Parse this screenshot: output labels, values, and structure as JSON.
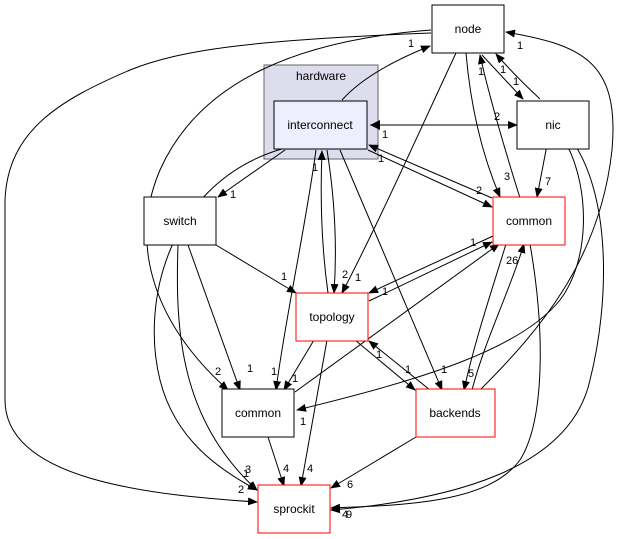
{
  "cluster": {
    "label": "hardware"
  },
  "colors": {
    "cluster_fill": "#ddddee",
    "cluster_stroke": "#666666",
    "inner_fill": "#eeeeff",
    "normal_stroke": "#000000",
    "red_stroke": "#ff0000"
  },
  "nodes": {
    "interconnect": {
      "label": "interconnect"
    },
    "node": {
      "label": "node"
    },
    "nic": {
      "label": "nic"
    },
    "common_right": {
      "label": "common"
    },
    "switch": {
      "label": "switch"
    },
    "topology": {
      "label": "topology"
    },
    "common_left": {
      "label": "common"
    },
    "backends": {
      "label": "backends"
    },
    "sprockit": {
      "label": "sprockit"
    }
  },
  "edges": [
    {
      "from": "interconnect",
      "to": "node",
      "label": "1"
    },
    {
      "from": "interconnect",
      "to": "nic",
      "label": "2"
    },
    {
      "from": "nic",
      "to": "interconnect",
      "label": "1"
    },
    {
      "from": "interconnect",
      "to": "common_right",
      "label": "2"
    },
    {
      "from": "common_right",
      "to": "interconnect",
      "label": "1"
    },
    {
      "from": "interconnect",
      "to": "switch",
      "label": "1"
    },
    {
      "from": "interconnect",
      "to": "topology",
      "label": "2"
    },
    {
      "from": "topology",
      "to": "interconnect",
      "label": "1"
    },
    {
      "from": "interconnect",
      "to": "common_left",
      "label": "1"
    },
    {
      "from": "interconnect",
      "to": "backends",
      "label": "1"
    },
    {
      "from": "interconnect",
      "to": "sprockit",
      "label": "3"
    },
    {
      "from": "node",
      "to": "nic",
      "label": "1"
    },
    {
      "from": "nic",
      "to": "node",
      "label": "1"
    },
    {
      "from": "common_right",
      "to": "node",
      "label": "1"
    },
    {
      "from": "backends",
      "to": "node",
      "label": "1"
    },
    {
      "from": "node",
      "to": "common_right",
      "label": "3"
    },
    {
      "from": "node",
      "to": "topology",
      "label": "1"
    },
    {
      "from": "node",
      "to": "common_left",
      "label": "2"
    },
    {
      "from": "node",
      "to": "sprockit",
      "label": "2"
    },
    {
      "from": "nic",
      "to": "common_right",
      "label": "7"
    },
    {
      "from": "nic",
      "to": "common_left",
      "label": "1"
    },
    {
      "from": "nic",
      "to": "sprockit",
      "label": "9"
    },
    {
      "from": "common_right",
      "to": "topology",
      "label": "1"
    },
    {
      "from": "topology",
      "to": "common_right",
      "label": "1"
    },
    {
      "from": "common_right",
      "to": "backends",
      "label": "5"
    },
    {
      "from": "backends",
      "to": "common_right",
      "label": "26"
    },
    {
      "from": "common_left",
      "to": "common_right",
      "label": "1"
    },
    {
      "from": "common_right",
      "to": "sprockit",
      "label": "4"
    },
    {
      "from": "switch",
      "to": "topology",
      "label": "1"
    },
    {
      "from": "switch",
      "to": "common_left",
      "label": "1"
    },
    {
      "from": "switch",
      "to": "sprockit",
      "label": "1"
    },
    {
      "from": "topology",
      "to": "common_left",
      "label": "1"
    },
    {
      "from": "topology",
      "to": "backends",
      "label": "1"
    },
    {
      "from": "backends",
      "to": "topology",
      "label": "1"
    },
    {
      "from": "topology",
      "to": "sprockit",
      "label": "4"
    },
    {
      "from": "common_left",
      "to": "sprockit",
      "label": "4"
    },
    {
      "from": "backends",
      "to": "sprockit",
      "label": "6"
    }
  ]
}
